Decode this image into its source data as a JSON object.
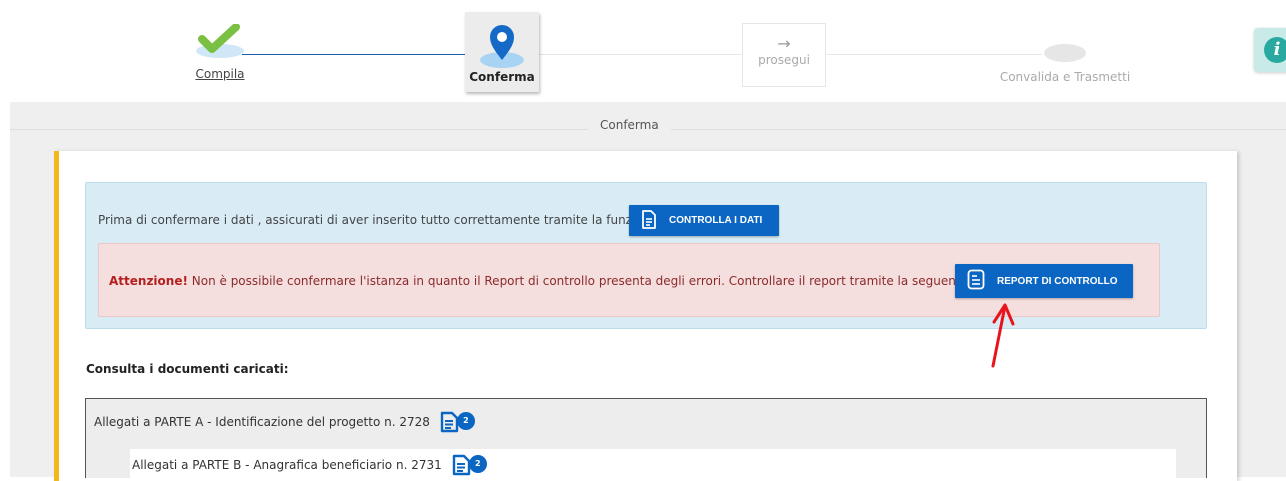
{
  "stepper": {
    "steps": [
      {
        "label": "Compila",
        "state": "done"
      },
      {
        "label": "Conferma",
        "state": "active"
      },
      {
        "label": "prosegui",
        "state": "next-button"
      },
      {
        "label": "Convalida e Trasmetti",
        "state": "pending"
      }
    ],
    "arrow_glyph": "→",
    "info_glyph": "i"
  },
  "section": {
    "title": "Conferma"
  },
  "check_notice": {
    "text": "Prima di confermare i dati , assicurati di aver inserito tutto correttamente tramite la funzione",
    "button_label": "CONTROLLA I DATI"
  },
  "alert": {
    "strong": "Attenzione!",
    "text": " Non è possibile confermare l'istanza in quanto il Report di controllo presenta degli errori. Controllare il report tramite la seguente funzione",
    "button_label": "REPORT DI CONTROLLO"
  },
  "documents": {
    "heading": "Consulta i documenti caricati:",
    "items": [
      {
        "label": "Allegati a PARTE A - Identificazione del progetto n. 2728",
        "count": "2"
      },
      {
        "label": "Allegati a PARTE B - Anagrafica beneficiario n. 2731",
        "count": "2"
      }
    ]
  },
  "colors": {
    "primary": "#0a66c2",
    "accent_border": "#f2b81c",
    "success": "#7ac143",
    "alert_text": "#b42020",
    "annotation_arrow": "#e8141c"
  }
}
